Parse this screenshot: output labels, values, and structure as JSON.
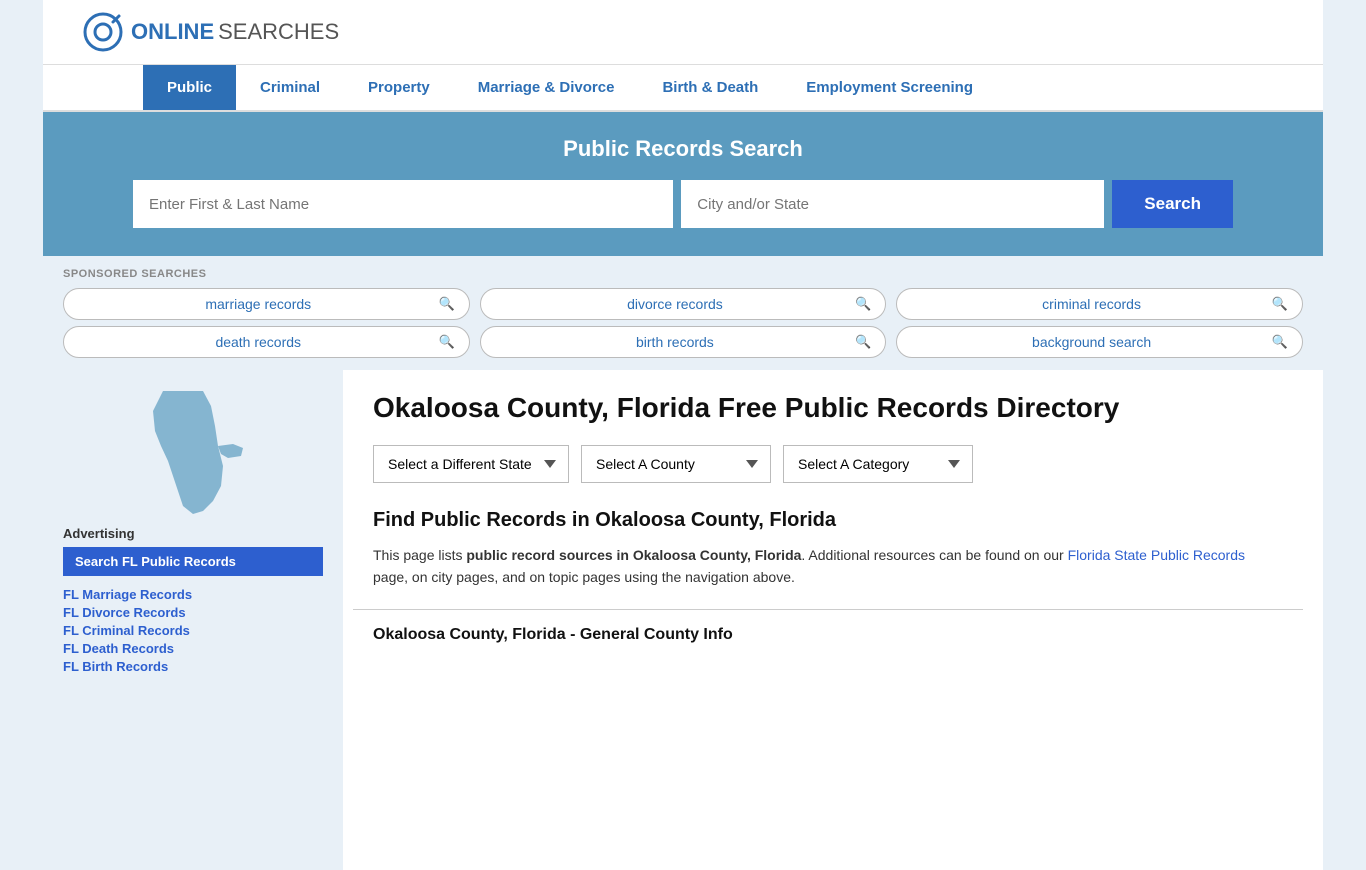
{
  "logo": {
    "online": "ONLINE",
    "searches": "SEARCHES"
  },
  "nav": {
    "items": [
      {
        "label": "Public",
        "active": true
      },
      {
        "label": "Criminal",
        "active": false
      },
      {
        "label": "Property",
        "active": false
      },
      {
        "label": "Marriage & Divorce",
        "active": false
      },
      {
        "label": "Birth & Death",
        "active": false
      },
      {
        "label": "Employment Screening",
        "active": false
      }
    ]
  },
  "search_band": {
    "title": "Public Records Search",
    "name_placeholder": "Enter First & Last Name",
    "location_placeholder": "City and/or State",
    "button_label": "Search"
  },
  "sponsored": {
    "label": "SPONSORED SEARCHES",
    "pills": [
      [
        {
          "text": "marriage records"
        },
        {
          "text": "divorce records"
        },
        {
          "text": "criminal records"
        }
      ],
      [
        {
          "text": "death records"
        },
        {
          "text": "birth records"
        },
        {
          "text": "background search"
        }
      ]
    ]
  },
  "page": {
    "title": "Okaloosa County, Florida Free Public Records Directory",
    "dropdowns": {
      "state": {
        "label": "Select a Different State"
      },
      "county": {
        "label": "Select A County"
      },
      "category": {
        "label": "Select A Category"
      }
    },
    "find_title": "Find Public Records in Okaloosa County, Florida",
    "find_desc_1": "This page lists ",
    "find_desc_bold": "public record sources in Okaloosa County, Florida",
    "find_desc_2": ". Additional resources can be found on our ",
    "find_link_text": "Florida State Public Records",
    "find_desc_3": " page, on city pages, and on topic pages using the navigation above.",
    "general_info_title": "Okaloosa County, Florida - General County Info"
  },
  "sidebar": {
    "ad_label": "Advertising",
    "search_btn": "Search FL Public Records",
    "links": [
      {
        "text": "FL Marriage Records"
      },
      {
        "text": "FL Divorce Records"
      },
      {
        "text": "FL Criminal Records"
      },
      {
        "text": "FL Death Records"
      },
      {
        "text": "FL Birth Records"
      }
    ]
  }
}
